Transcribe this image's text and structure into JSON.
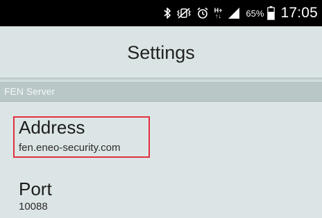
{
  "status_bar": {
    "icons": [
      "bluetooth-icon",
      "vibrate-mute-icon",
      "alarm-icon",
      "network-hplus-icon",
      "signal-icon",
      "battery-icon"
    ],
    "network_label_top": "H+",
    "network_label_bottom": "↑↓",
    "battery_percent": "65%",
    "time": "17:05"
  },
  "header": {
    "title": "Settings"
  },
  "section": {
    "label": "FEN Server"
  },
  "preferences": [
    {
      "title": "Address",
      "summary": "fen.eneo-security.com"
    },
    {
      "title": "Port",
      "summary": "10088"
    }
  ],
  "colors": {
    "status_bar_bg": "#000000",
    "background": "#dce5e5",
    "section_bg": "#b9c7c7",
    "highlight": "#e0303e"
  }
}
